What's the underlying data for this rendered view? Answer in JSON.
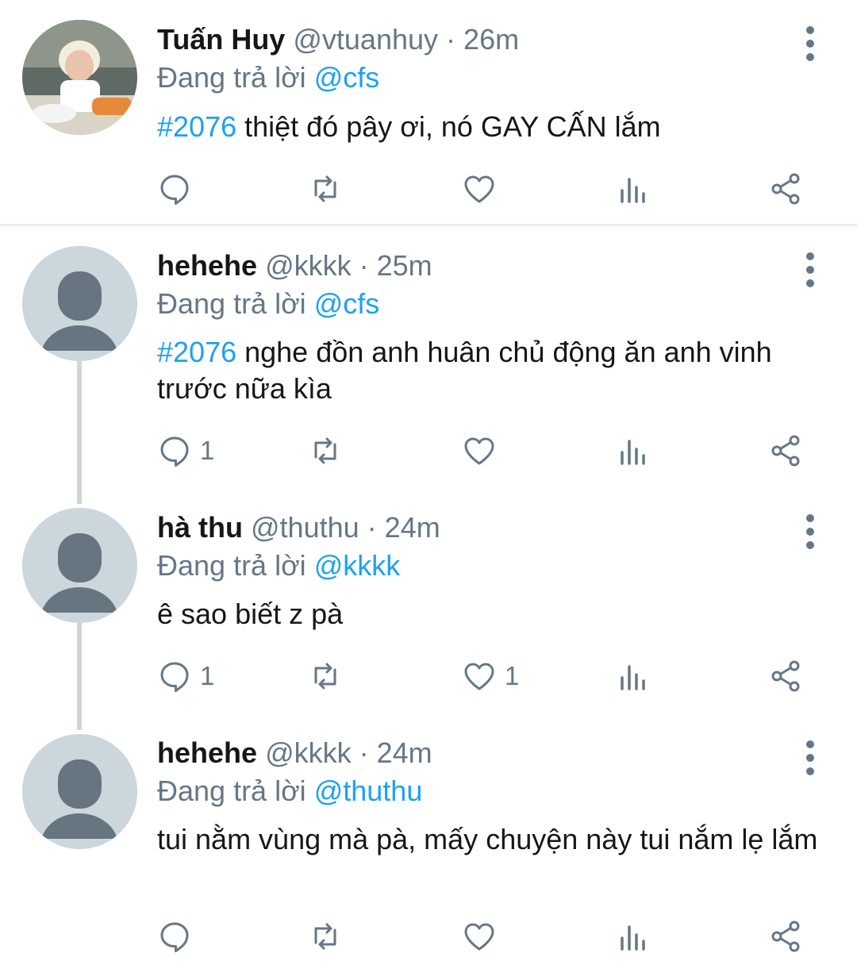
{
  "colors": {
    "accent": "#1da1f2",
    "muted": "#657786",
    "text": "#14171a",
    "avatar_bg": "#ccd6dd"
  },
  "tweets": [
    {
      "name": "Tuấn Huy",
      "handle": "@vtuanhuy",
      "separator": "·",
      "time": "26m",
      "replying_prefix": "Đang trả lời",
      "replying_to": "@cfs",
      "hashtag": "#2076",
      "text": " thiệt đó pây ơi, nó GAY CẤN lắm",
      "avatar": "photo-avatar",
      "reply_count": "",
      "retweet_count": "",
      "like_count": ""
    },
    {
      "name": "hehehe",
      "handle": "@kkkk",
      "separator": "·",
      "time": "25m",
      "replying_prefix": "Đang trả lời",
      "replying_to": "@cfs",
      "hashtag": "#2076",
      "text": " nghe đồn anh huân chủ động ăn anh vinh trước nữa kìa",
      "avatar": "default-avatar",
      "reply_count": "1",
      "retweet_count": "",
      "like_count": ""
    },
    {
      "name": "hà thu",
      "handle": "@thuthu",
      "separator": "·",
      "time": "24m",
      "replying_prefix": "Đang trả lời",
      "replying_to": "@kkkk",
      "hashtag": "",
      "text": "ê sao biết z pà",
      "avatar": "default-avatar",
      "reply_count": "1",
      "retweet_count": "",
      "like_count": "1"
    },
    {
      "name": "hehehe",
      "handle": "@kkkk",
      "separator": "·",
      "time": "24m",
      "replying_prefix": "Đang trả lời",
      "replying_to": "@thuthu",
      "hashtag": "",
      "text": "tui nằm vùng mà pà, mấy chuyện này tui nắm lẹ lắm",
      "avatar": "default-avatar",
      "reply_count": "",
      "retweet_count": "",
      "like_count": ""
    }
  ]
}
